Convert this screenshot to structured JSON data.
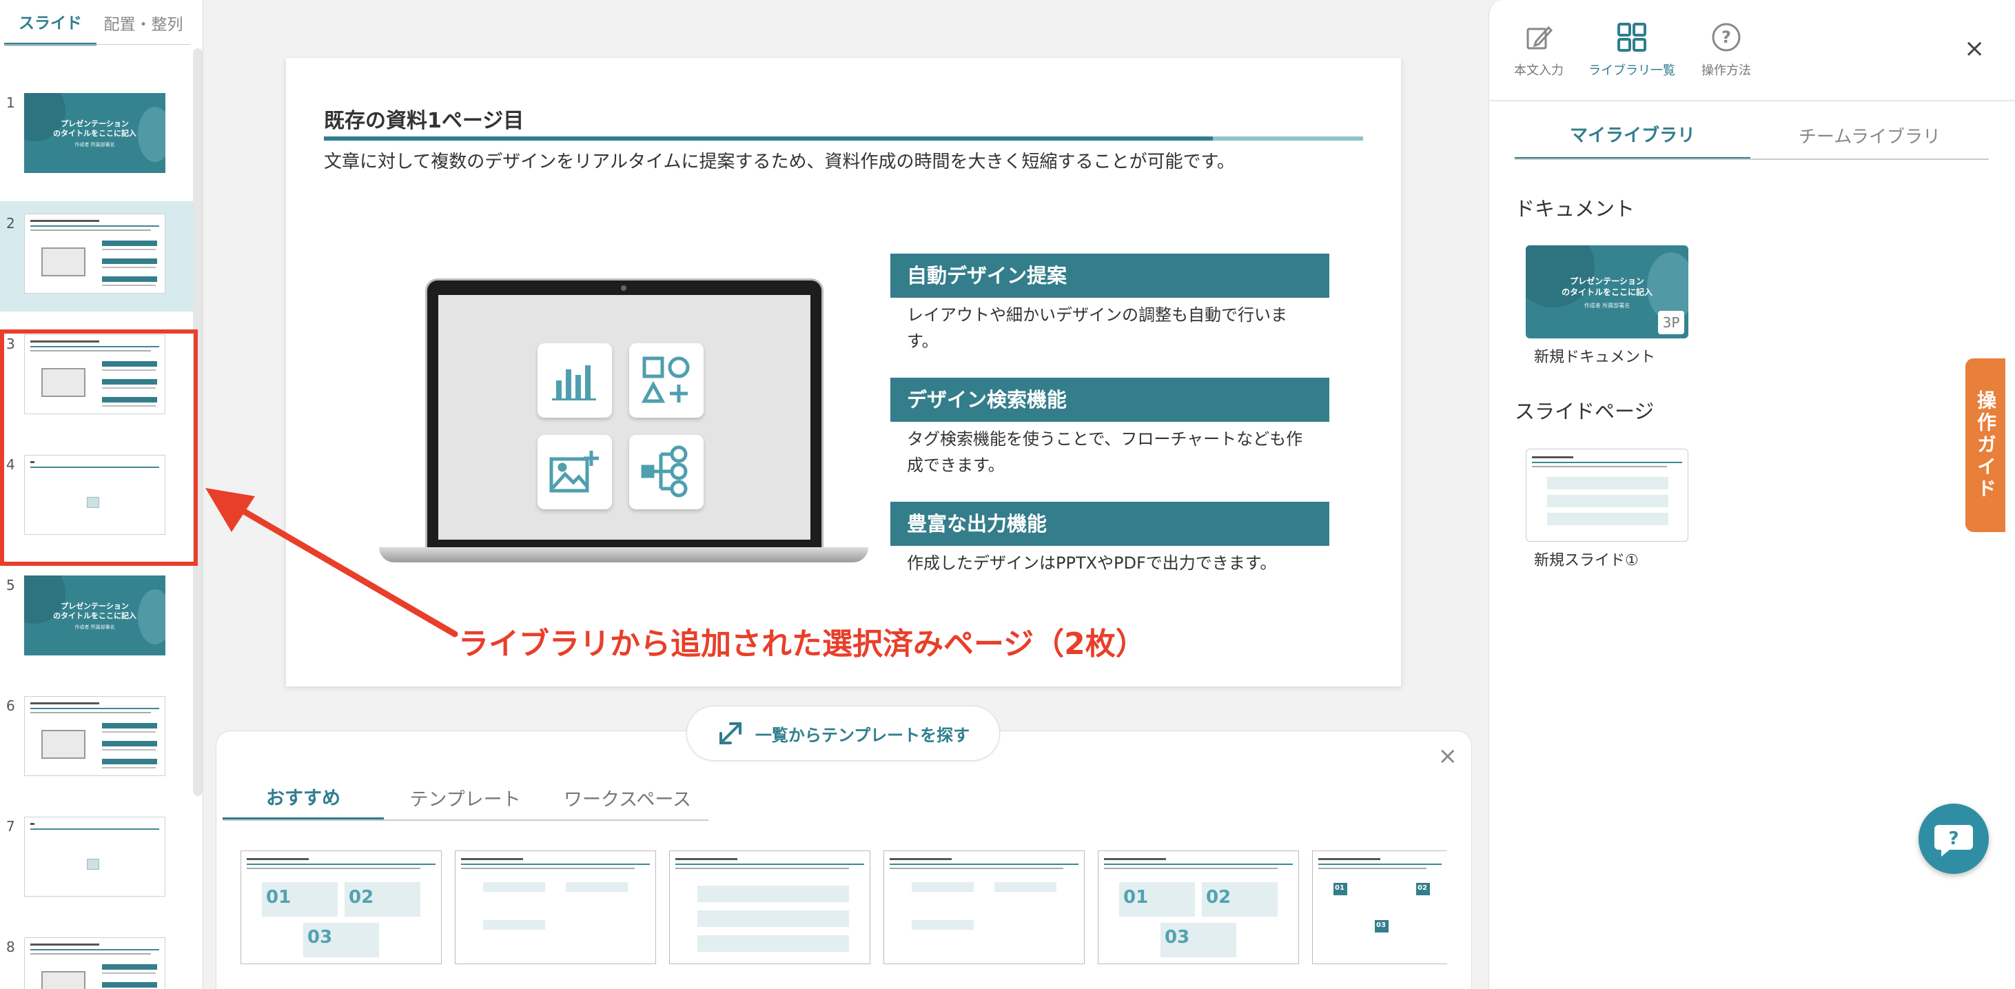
{
  "left_panel": {
    "tabs": [
      {
        "label": "スライド",
        "active": true
      },
      {
        "label": "配置・整列",
        "active": false
      }
    ],
    "slides": [
      {
        "num": "1",
        "kind": "title",
        "title": "プレゼンテーション\nのタイトルをここに記入",
        "sub": "作成者 所属部署名"
      },
      {
        "num": "2",
        "kind": "content",
        "active": true
      },
      {
        "num": "3",
        "kind": "content"
      },
      {
        "num": "4",
        "kind": "blank"
      },
      {
        "num": "5",
        "kind": "title",
        "title": "プレゼンテーション\nのタイトルをここに記入",
        "sub": "作成者 所属部署名"
      },
      {
        "num": "6",
        "kind": "content"
      },
      {
        "num": "7",
        "kind": "blank"
      },
      {
        "num": "8",
        "kind": "content"
      }
    ]
  },
  "slide": {
    "title": "既存の資料1ページ目",
    "lead": "文章に対して複数のデザインをリアルタイムに提案するため、資料作成の時間を大きく短縮することが可能です。",
    "features": [
      {
        "heading": "自動デザイン提案",
        "body": "レイアウトや細かいデザインの調整も自動で行います。"
      },
      {
        "heading": "デザイン検索機能",
        "body": "タグ検索機能を使うことで、フローチャートなども作成できます。"
      },
      {
        "heading": "豊富な出力機能",
        "body": "作成したデザインはPPTXやPDFで出力できます。"
      }
    ]
  },
  "annotation": "ライブラリから追加された選択済みページ（2枚）",
  "bottom_panel": {
    "find_template_label": "一覧からテンプレートを探す",
    "tabs": [
      {
        "label": "おすすめ",
        "active": true
      },
      {
        "label": "テンプレート",
        "active": false
      },
      {
        "label": "ワークスペース",
        "active": false
      }
    ],
    "cards": [
      {
        "style": "numbered",
        "numbers": [
          "01",
          "02",
          "03"
        ]
      },
      {
        "style": "grid"
      },
      {
        "style": "list"
      },
      {
        "style": "grid"
      },
      {
        "style": "numbered",
        "numbers": [
          "01",
          "02",
          "03"
        ]
      },
      {
        "style": "tagged",
        "numbers": [
          "01",
          "02",
          "03"
        ]
      }
    ]
  },
  "right_panel": {
    "icons": [
      {
        "label": "本文入力",
        "icon": "edit-icon",
        "active": false
      },
      {
        "label": "ライブラリ一覧",
        "icon": "grid-icon",
        "active": true
      },
      {
        "label": "操作方法",
        "icon": "help-icon",
        "active": false
      }
    ],
    "tabs": [
      {
        "label": "マイライブラリ",
        "active": true
      },
      {
        "label": "チームライブラリ",
        "active": false
      }
    ],
    "documents_heading": "ドキュメント",
    "document_item": {
      "label": "新規ドキュメント",
      "badge": "3P",
      "title": "プレゼンテーション\nのタイトルをここに記入",
      "sub": "作成者 所属部署名"
    },
    "slides_heading": "スライドページ",
    "slide_item": {
      "label": "新規スライド①"
    },
    "guide_label": "操作ガイド"
  },
  "colors": {
    "accent": "#2f7d8e",
    "annotation": "#e83f2a",
    "guide": "#e87f3a"
  }
}
